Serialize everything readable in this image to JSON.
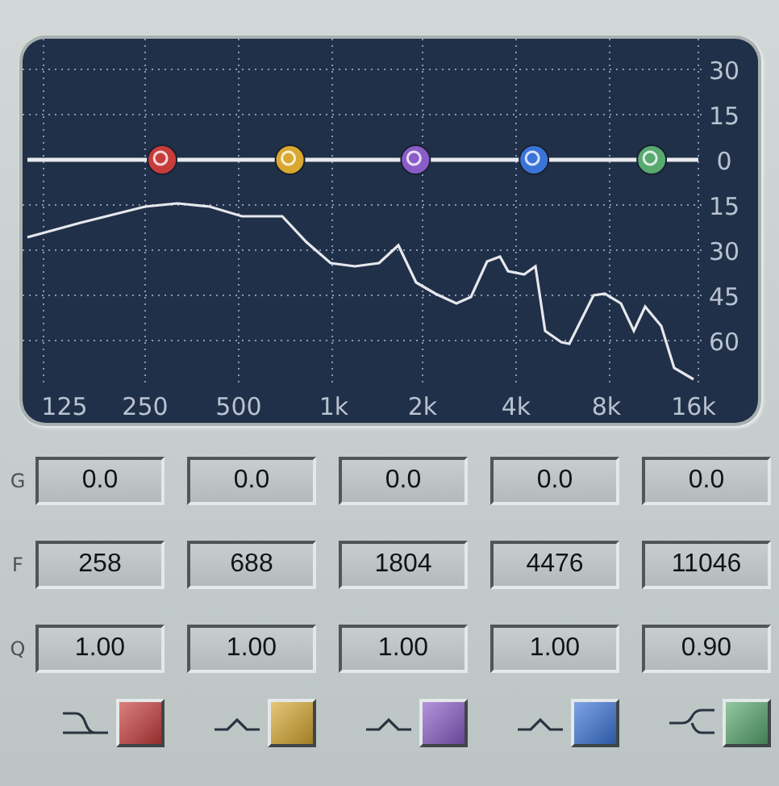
{
  "graph": {
    "y_labels": [
      "30",
      "15",
      "0",
      "15",
      "30",
      "45",
      "60"
    ],
    "x_labels": [
      "125",
      "250",
      "500",
      "1k",
      "2k",
      "4k",
      "8k",
      "16k"
    ]
  },
  "row_labels": [
    "G",
    "F",
    "Q"
  ],
  "bands": [
    {
      "gain": "0.0",
      "freq": "258",
      "q": "1.00",
      "kind": "low_shelf",
      "color": "#c83c3c"
    },
    {
      "gain": "0.0",
      "freq": "688",
      "q": "1.00",
      "kind": "peak",
      "color": "#d8a830"
    },
    {
      "gain": "0.0",
      "freq": "1804",
      "q": "1.00",
      "kind": "peak",
      "color": "#8a5cc8"
    },
    {
      "gain": "0.0",
      "freq": "4476",
      "q": "1.00",
      "kind": "peak",
      "color": "#3a74d8"
    },
    {
      "gain": "0.0",
      "freq": "11046",
      "q": "0.90",
      "kind": "high_shelf",
      "color": "#58a870"
    }
  ]
}
